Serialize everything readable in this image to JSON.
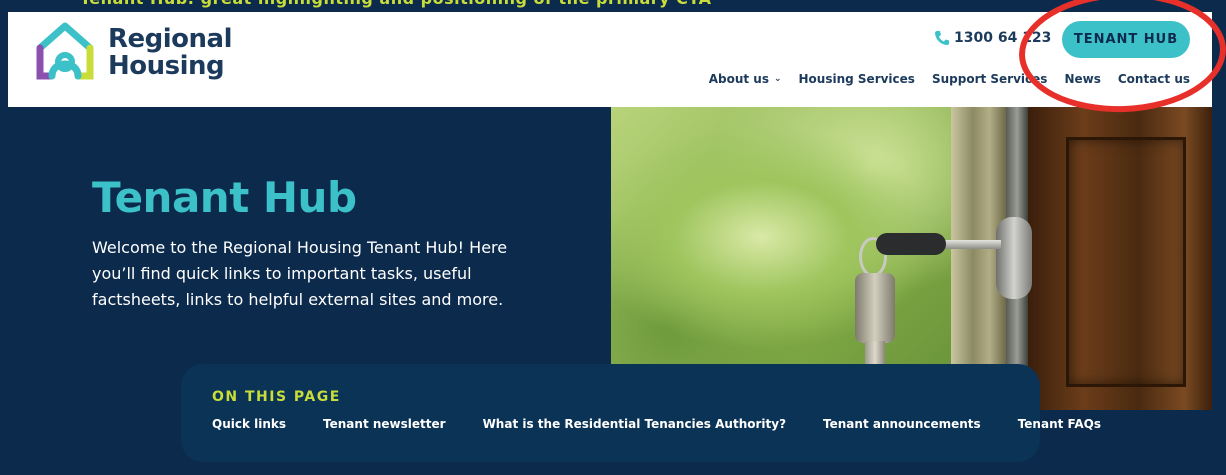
{
  "colors": {
    "navy": "#0b2a4c",
    "teal": "#3cc1c8",
    "lime": "#c8dc3a",
    "annotation_red": "#e8302b"
  },
  "top_strip": {
    "clipped_text": "Tenant Hub: great highlighting and positioning of the primary CTA"
  },
  "header": {
    "brand_line1": "Regional",
    "brand_line2": "Housing",
    "phone": "1300 64​ 123",
    "phone_icon": "phone-icon",
    "cta_label": "TENANT HUB",
    "nav": [
      {
        "label": "About us",
        "has_dropdown": true
      },
      {
        "label": "Housing Services"
      },
      {
        "label": "Support Services"
      },
      {
        "label": "News"
      },
      {
        "label": "Contact us"
      }
    ]
  },
  "hero": {
    "title": "Tenant Hub",
    "text": "Welcome to the Regional Housing Tenant Hub! Here you’ll find quick links to important tasks, useful factsheets, links to helpful external sites and more."
  },
  "on_this_page": {
    "title": "ON THIS PAGE",
    "links": [
      "Quick links",
      "Tenant newsletter",
      "What is the Residential Tenancies Authority?",
      "Tenant announcements",
      "Tenant FAQs"
    ]
  }
}
